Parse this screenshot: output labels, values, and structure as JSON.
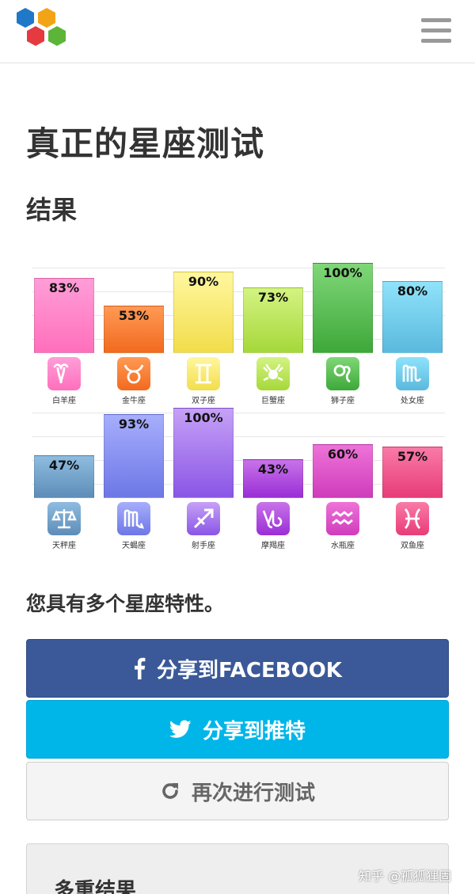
{
  "header": {
    "logo_icon": "hexagon-cluster-logo",
    "menu_icon": "hamburger-menu-icon"
  },
  "page": {
    "title": "真正的星座测试",
    "result_heading": "结果",
    "trait_text": "您具有多个星座特性。"
  },
  "chart_data": {
    "type": "bar",
    "ylim": [
      0,
      100
    ],
    "grid": true,
    "rows": [
      {
        "categories": [
          "白羊座",
          "金牛座",
          "双子座",
          "巨蟹座",
          "狮子座",
          "处女座"
        ],
        "values": [
          83,
          53,
          90,
          73,
          100,
          80
        ],
        "labels": [
          "83%",
          "53%",
          "90%",
          "73%",
          "100%",
          "80%"
        ],
        "colors": [
          [
            "#ff9ed8",
            "#ff6fbb"
          ],
          [
            "#ff9a55",
            "#f26a1f"
          ],
          [
            "#fff7a0",
            "#f2dd4a"
          ],
          [
            "#d4f383",
            "#a5d83a"
          ],
          [
            "#7fd777",
            "#3ea83a"
          ],
          [
            "#8fe3fa",
            "#5ab9de"
          ]
        ],
        "icons": [
          "aries-icon",
          "taurus-icon",
          "gemini-icon",
          "cancer-icon",
          "leo-icon",
          "virgo-icon"
        ]
      },
      {
        "categories": [
          "天秤座",
          "天蝎座",
          "射手座",
          "摩羯座",
          "水瓶座",
          "双鱼座"
        ],
        "values": [
          47,
          93,
          100,
          43,
          60,
          57
        ],
        "labels": [
          "47%",
          "93%",
          "100%",
          "43%",
          "60%",
          "57%"
        ],
        "colors": [
          [
            "#8fbcdf",
            "#5d8db8"
          ],
          [
            "#a6aefc",
            "#6d77e6"
          ],
          [
            "#c6a1f6",
            "#8a55e6"
          ],
          [
            "#c873e9",
            "#9a2ed6"
          ],
          [
            "#ee73d8",
            "#cf3cbc"
          ],
          [
            "#f97ba7",
            "#e83c77"
          ]
        ],
        "icons": [
          "libra-icon",
          "scorpio-icon",
          "sagittarius-icon",
          "capricorn-icon",
          "aquarius-icon",
          "pisces-icon"
        ]
      }
    ]
  },
  "buttons": {
    "facebook_label": "分享到FACEBOOK",
    "twitter_label": "分享到推特",
    "retry_label": "再次进行测试"
  },
  "multi_result": {
    "title": "多重结果"
  },
  "watermark": "知乎 @孤狐狸固"
}
